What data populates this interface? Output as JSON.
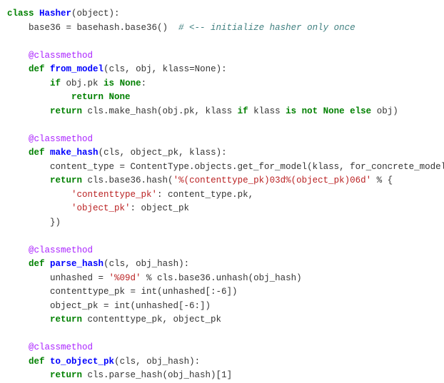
{
  "code": {
    "l01": {
      "kw_class": "class",
      "name": "Hasher",
      "rest": "(object):"
    },
    "l02": {
      "lhs": "    base36 = basehash.base36()  ",
      "cmt": "# <-- initialize hasher only once"
    },
    "l04": {
      "dec": "    @classmethod"
    },
    "l05": {
      "indent": "    ",
      "kw_def": "def",
      "sp": " ",
      "name": "from_model",
      "rest": "(cls, obj, klass=None):"
    },
    "l06": {
      "indent": "        ",
      "kw_if": "if",
      "mid": " obj.pk ",
      "kw_is": "is",
      "sp": " ",
      "kw_none": "None",
      "colon": ":"
    },
    "l07": {
      "indent": "            ",
      "kw_return": "return",
      "sp": " ",
      "kw_none": "None"
    },
    "l08": {
      "indent": "        ",
      "kw_return": "return",
      "mid1": " cls.make_hash(obj.pk, klass ",
      "kw_if": "if",
      "mid2": " klass ",
      "kw_isnot": "is not",
      "sp": " ",
      "kw_none": "None",
      "sp2": " ",
      "kw_else": "else",
      "rest": " obj)"
    },
    "l10": {
      "dec": "    @classmethod"
    },
    "l11": {
      "indent": "    ",
      "kw_def": "def",
      "sp": " ",
      "name": "make_hash",
      "rest": "(cls, object_pk, klass):"
    },
    "l12": {
      "txt": "        content_type = ContentType.objects.get_for_model(klass, for_concrete_model=Fals"
    },
    "l13": {
      "indent": "        ",
      "kw_return": "return",
      "mid": " cls.base36.hash(",
      "str": "'%(contenttype_pk)03d%(object_pk)06d'",
      "rest": " % {"
    },
    "l14": {
      "indent": "            ",
      "str": "'contenttype_pk'",
      "rest": ": content_type.pk,"
    },
    "l15": {
      "indent": "            ",
      "str": "'object_pk'",
      "rest": ": object_pk"
    },
    "l16": {
      "txt": "        })"
    },
    "l18": {
      "dec": "    @classmethod"
    },
    "l19": {
      "indent": "    ",
      "kw_def": "def",
      "sp": " ",
      "name": "parse_hash",
      "rest": "(cls, obj_hash):"
    },
    "l20": {
      "indent": "        unhashed = ",
      "str": "'%09d'",
      "rest": " % cls.base36.unhash(obj_hash)"
    },
    "l21": {
      "txt": "        contenttype_pk = int(unhashed[:-6])"
    },
    "l22": {
      "txt": "        object_pk = int(unhashed[-6:])"
    },
    "l23": {
      "indent": "        ",
      "kw_return": "return",
      "rest": " contenttype_pk, object_pk"
    },
    "l25": {
      "dec": "    @classmethod"
    },
    "l26": {
      "indent": "    ",
      "kw_def": "def",
      "sp": " ",
      "name": "to_object_pk",
      "rest": "(cls, obj_hash):"
    },
    "l27": {
      "indent": "        ",
      "kw_return": "return",
      "rest": " cls.parse_hash(obj_hash)[1]"
    }
  }
}
